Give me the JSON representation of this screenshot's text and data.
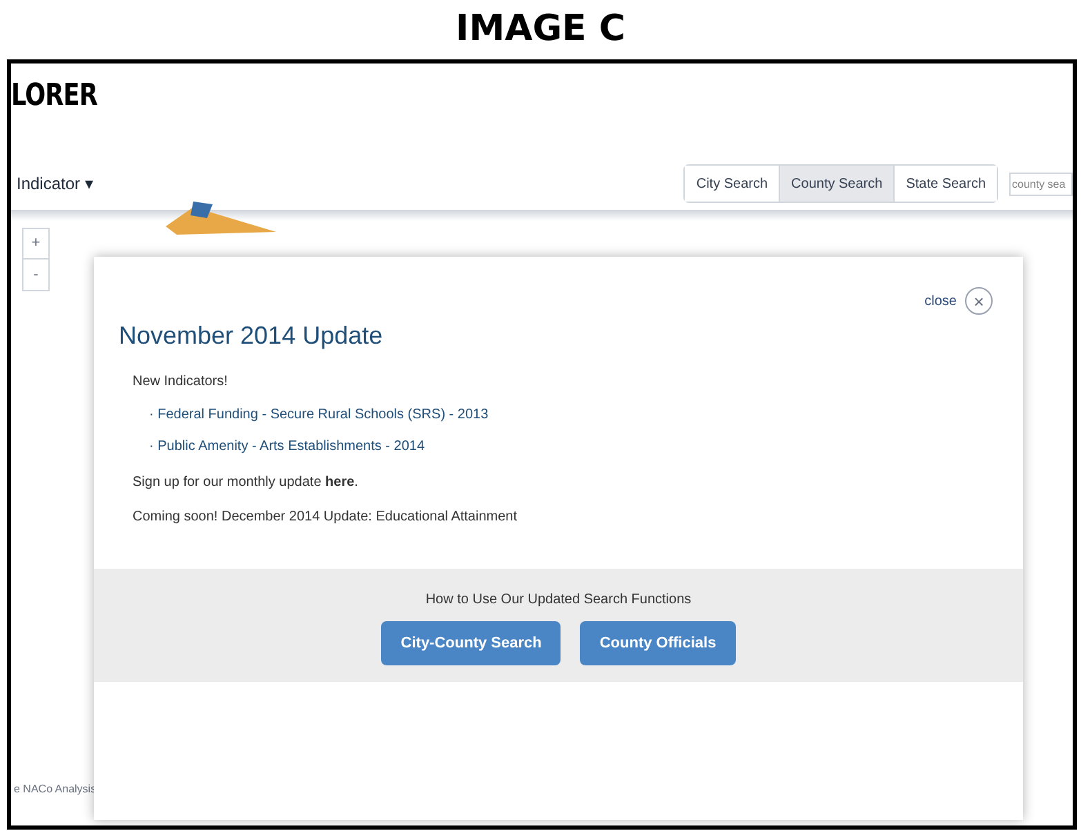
{
  "figure_title": "IMAGE C",
  "header": {
    "logo": "LORER"
  },
  "toolbar": {
    "indicator_menu": "Indicator ▾",
    "search_tabs": [
      {
        "label": "City Search",
        "selected": false
      },
      {
        "label": "County Search",
        "selected": true
      },
      {
        "label": "State Search",
        "selected": false
      }
    ],
    "search": {
      "placeholder": "county sea"
    }
  },
  "map_controls": [
    "+",
    "-"
  ],
  "source_note": "e NACo Analysis",
  "modal": {
    "close_label": "close",
    "close_icon": "×",
    "title": "November 2014 Update",
    "intro": "New Indicators!",
    "indicators": [
      "· Federal Funding - Secure Rural Schools (SRS) - 2013",
      "· Public Amenity - Arts Establishments - 2014"
    ],
    "signup": "Sign up for our monthly update **here**.",
    "coming_soon": "Coming soon! December 2014 Update: Educational Attainment",
    "footer_heading": "How to Use Our Updated Search Functions",
    "buttons": [
      "City-County Search",
      "County Officials"
    ]
  }
}
